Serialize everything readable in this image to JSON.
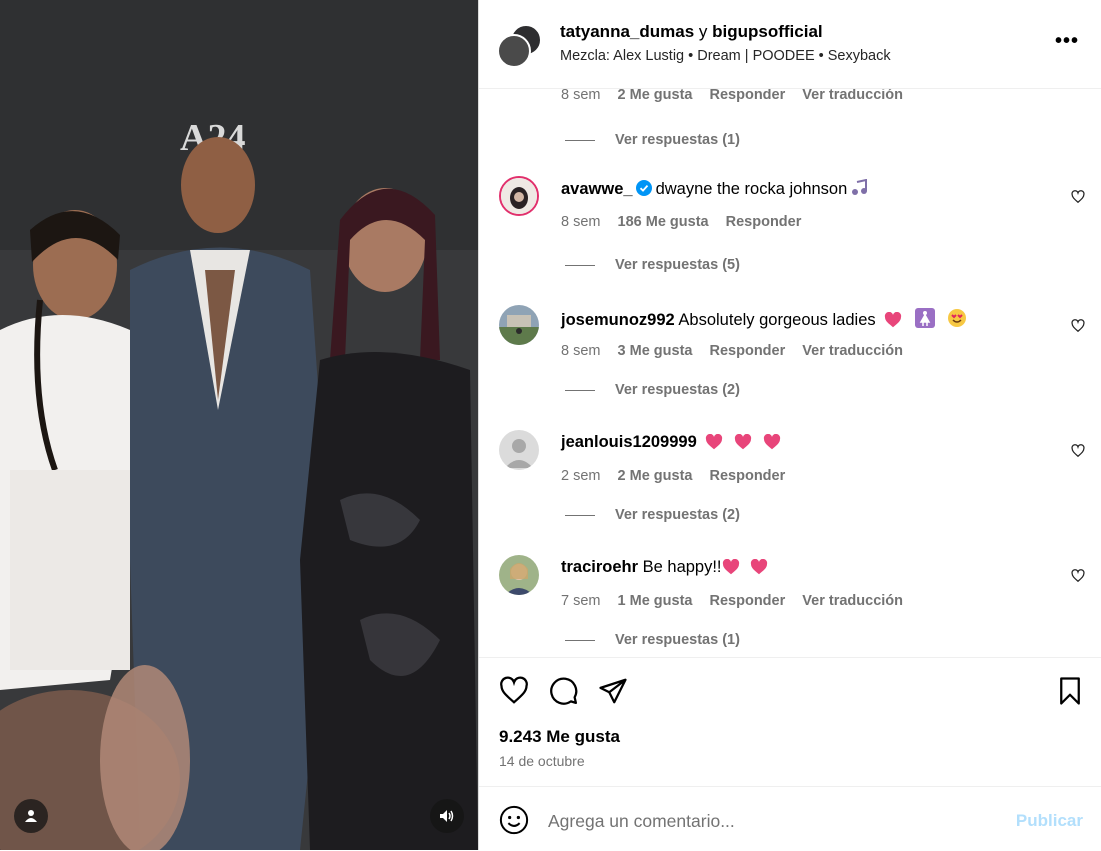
{
  "post": {
    "user1": "tatyanna_dumas",
    "joiner": "y",
    "user2": "bigupsofficial",
    "audio": "Mezcla: Alex Lustig • Dream | POODEE • Sexyback",
    "more_label": "•••",
    "media_sign": "A24"
  },
  "top_partial": {
    "time": "8 sem",
    "likes": "2 Me gusta",
    "reply": "Responder",
    "translate": "Ver traducción",
    "replies": "Ver respuestas (1)"
  },
  "comments": [
    {
      "user": "avawwe_",
      "text": "dwayne the rocka johnson",
      "time": "8 sem",
      "likes": "186 Me gusta",
      "reply": "Responder",
      "translate": "",
      "replies": "Ver respuestas (5)"
    },
    {
      "user": "josemunoz992",
      "text": "Absolutely gorgeous ladies",
      "time": "8 sem",
      "likes": "3 Me gusta",
      "reply": "Responder",
      "translate": "Ver traducción",
      "replies": "Ver respuestas (2)"
    },
    {
      "user": "jeanlouis1209999",
      "text": "",
      "time": "2 sem",
      "likes": "2 Me gusta",
      "reply": "Responder",
      "translate": "",
      "replies": "Ver respuestas (2)"
    },
    {
      "user": "traciroehr",
      "text": "Be happy!!",
      "time": "7 sem",
      "likes": "1 Me gusta",
      "reply": "Responder",
      "translate": "Ver traducción",
      "replies": "Ver respuestas (1)"
    }
  ],
  "footer": {
    "likes": "9.243 Me gusta",
    "date": "14 de octubre",
    "placeholder": "Agrega un comentario...",
    "publish": "Publicar"
  },
  "colors": {
    "accent": "#0095f6",
    "publish_disabled": "#b2dffc",
    "heart": "#ed4956"
  }
}
